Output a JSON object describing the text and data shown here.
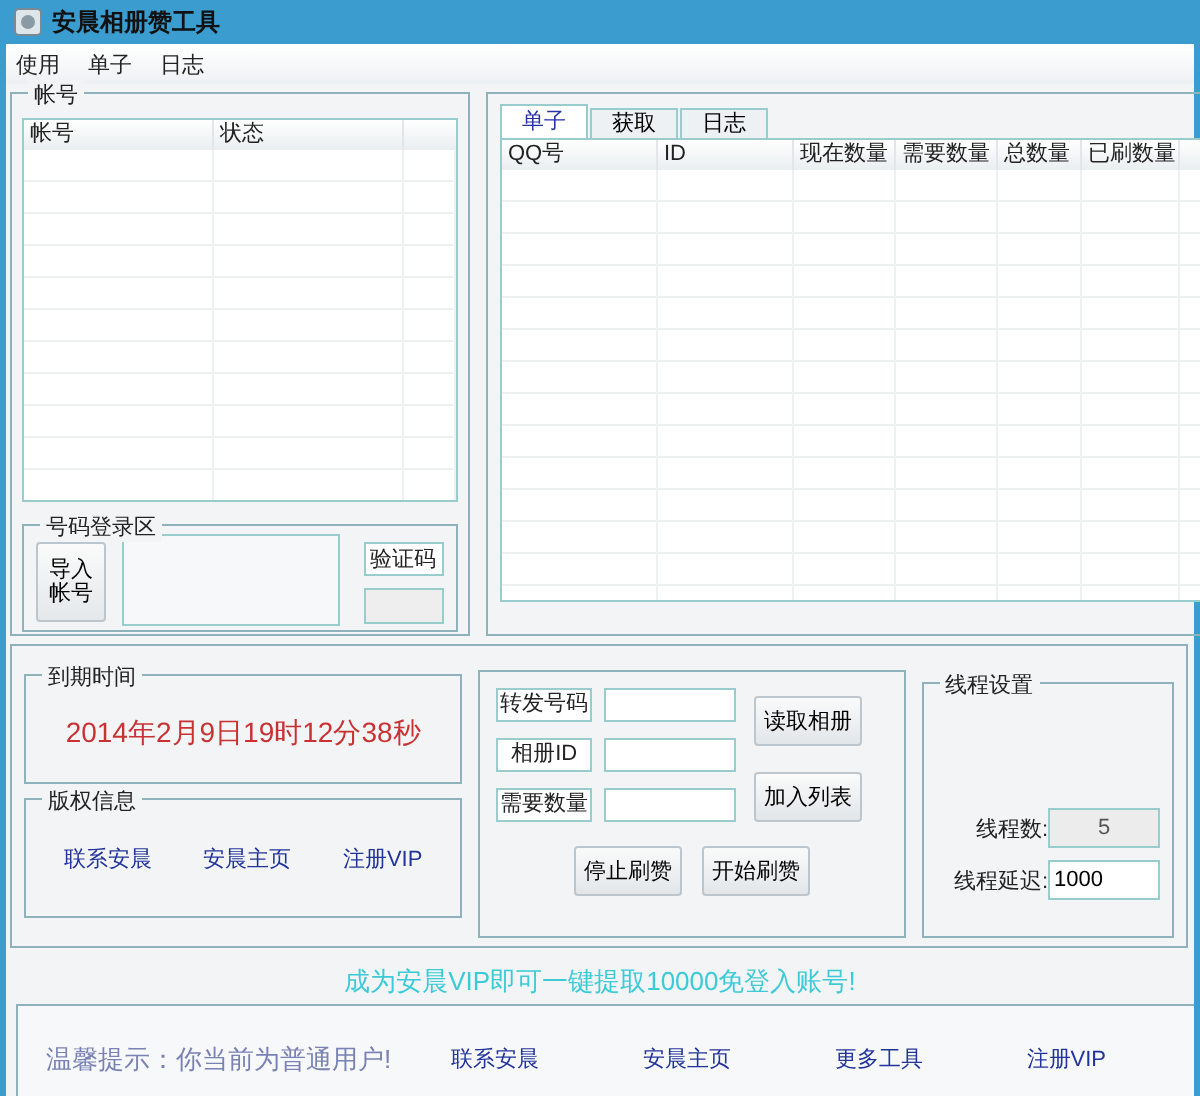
{
  "window": {
    "title": "安晨相册赞工具"
  },
  "menu": [
    "使用",
    "单子",
    "日志"
  ],
  "accounts": {
    "title": "帐号",
    "columns": [
      "帐号",
      "状态"
    ]
  },
  "login": {
    "title": "号码登录区",
    "import_button": "导入帐号",
    "captcha_label": "验证码"
  },
  "tabs": [
    {
      "label": "单子",
      "selected": true
    },
    {
      "label": "获取",
      "selected": false
    },
    {
      "label": "日志",
      "selected": false
    }
  ],
  "orders_table": {
    "columns": [
      "QQ号",
      "ID",
      "现在数量",
      "需要数量",
      "总数量",
      "已刷数量"
    ]
  },
  "expiry": {
    "title": "到期时间",
    "value": "2014年2月9日19时12分38秒"
  },
  "copyright": {
    "title": "版权信息",
    "links": [
      "联系安晨",
      "安晨主页",
      "注册VIP"
    ]
  },
  "order_form": {
    "fields": [
      {
        "label": "转发号码"
      },
      {
        "label": "相册ID"
      },
      {
        "label": "需要数量"
      }
    ],
    "side_buttons": [
      "读取相册",
      "加入列表"
    ],
    "buttons": [
      "停止刷赞",
      "开始刷赞"
    ]
  },
  "thread_settings": {
    "title": "线程设置",
    "fields": [
      {
        "label": "线程数:",
        "value": "5",
        "disabled": true
      },
      {
        "label": "线程延迟:",
        "value": "1000",
        "disabled": false
      }
    ]
  },
  "banner": "成为安晨VIP即可一键提取10000免登入账号!",
  "footer": {
    "notice": "温馨提示：你当前为普通用户!",
    "links": [
      "联系安晨",
      "安晨主页",
      "更多工具",
      "注册VIP"
    ]
  }
}
